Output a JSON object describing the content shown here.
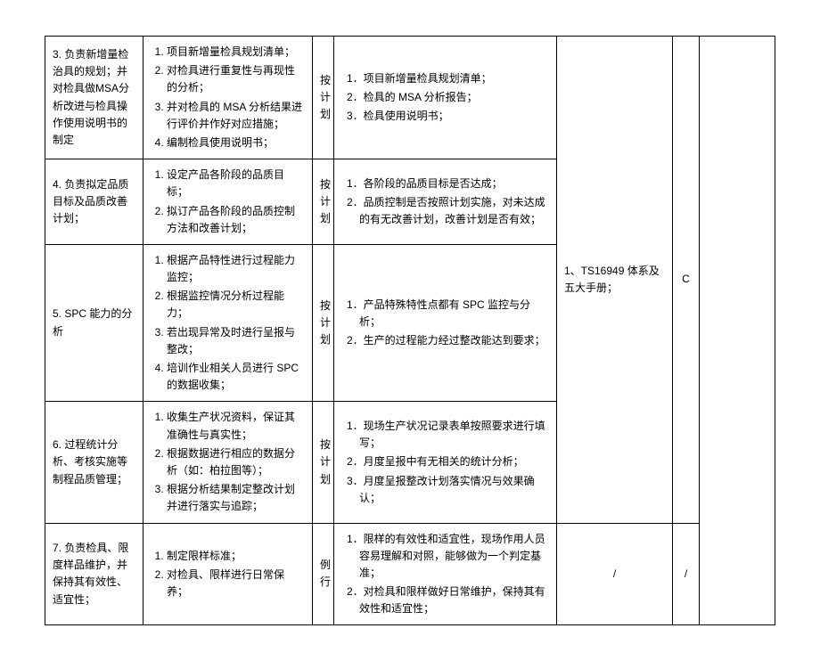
{
  "rows": [
    {
      "c1": "3. 负责新增量检治具的规划；并对检具做MSA分析改进与检具操作使用说明书的制定",
      "c2": [
        "项目新增量检具规划清单；",
        "对检具进行重复性与再现性的分析；",
        "并对检具的 MSA 分析结果进行评价并作好对应措施；",
        "编制检具使用说明书；"
      ],
      "c3": "按计划",
      "c4": [
        "1．项目新增量检具规划清单；",
        "2．检具的 MSA 分析报告；",
        "3．检具使用说明书；"
      ],
      "c5": "1、TS16949 体系及五大手册；",
      "c6": "C"
    },
    {
      "c1": "4. 负责拟定品质目标及品质改善计划；",
      "c2": [
        "设定产品各阶段的品质目标；",
        "拟订产品各阶段的品质控制方法和改善计划；"
      ],
      "c3": "按计划",
      "c4": [
        "1．各阶段的品质目标是否达成；",
        "2．品质控制是否按照计划实施，对未达成的有无改善计划，改善计划是否有效；"
      ]
    },
    {
      "c1": "5. SPC 能力的分析",
      "c2": [
        "根据产品特性进行过程能力监控；",
        "根据监控情况分析过程能力；",
        "若出现异常及时进行呈报与整改；",
        "培训作业相关人员进行 SPC 的数据收集；"
      ],
      "c3": "按计划",
      "c4": [
        "1．产品特殊特性点都有 SPC 监控与分析；",
        "2．生产的过程能力经过整改能达到要求；"
      ]
    },
    {
      "c1": "6. 过程统计分析、考核实施等制程品质管理；",
      "c2": [
        "收集生产状况资料，保证其准确性与真实性；",
        "根据数据进行相应的数据分析（如：柏拉图等）；",
        "根据分析结果制定整改计划并进行落实与追踪；"
      ],
      "c3": "按计划",
      "c4": [
        "1．现场生产状况记录表单按照要求进行填写；",
        "2．月度呈报中有无相关的统计分析；",
        "3．月度呈报整改计划落实情况与效果确认；"
      ]
    },
    {
      "c1": "7. 负责检具、限度样品维护，并保持其有效性、适宜性；",
      "c2": [
        "制定限样标准；",
        "对检具、限样进行日常保养；"
      ],
      "c3": "例行",
      "c4": [
        "1．限样的有效性和适宜性，现场作用人员容易理解和对照，能够做为一个判定基准；",
        "2．对检具和限样做好日常维护，保持其有效性和适宜性；"
      ],
      "c5": "/",
      "c6": "/"
    }
  ]
}
